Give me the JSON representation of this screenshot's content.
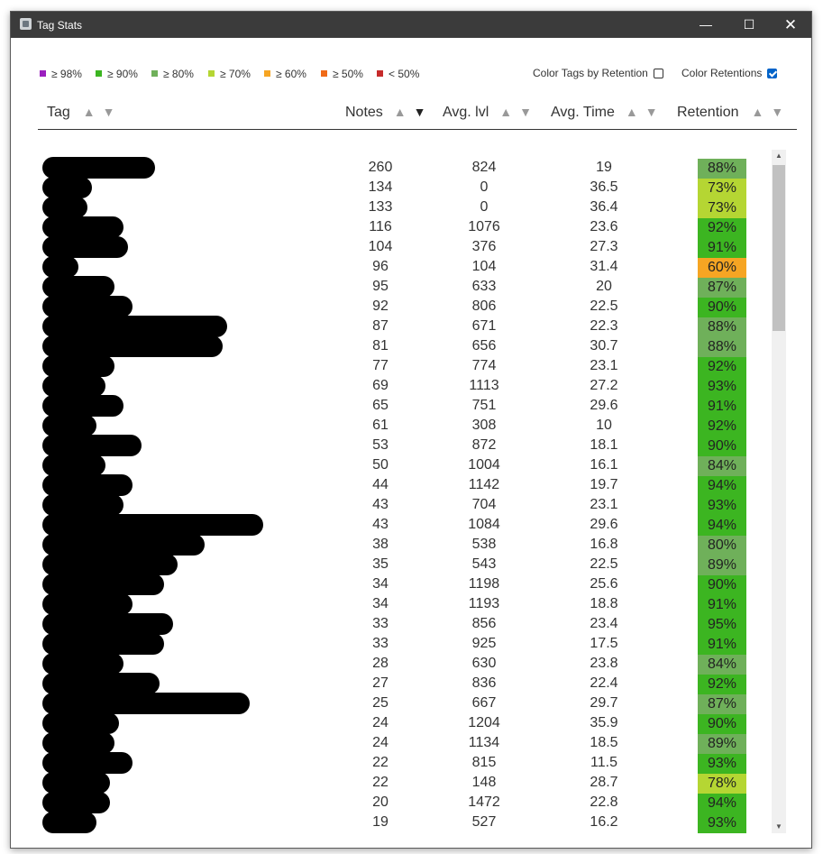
{
  "window": {
    "title": "Tag Stats"
  },
  "legend": [
    {
      "label": "≥ 98%",
      "color": "#9b1fbf"
    },
    {
      "label": "≥ 90%",
      "color": "#3cb521"
    },
    {
      "label": "≥ 80%",
      "color": "#6fb05a"
    },
    {
      "label": "≥ 70%",
      "color": "#b5d633"
    },
    {
      "label": "≥ 60%",
      "color": "#f6a523"
    },
    {
      "label": "≥ 50%",
      "color": "#f06a17"
    },
    {
      "label": "< 50%",
      "color": "#c62b2b"
    }
  ],
  "options": {
    "color_tags_label": "Color Tags by Retention",
    "color_tags_checked": false,
    "color_retentions_label": "Color Retentions",
    "color_retentions_checked": true
  },
  "columns": {
    "tag": "Tag",
    "notes": "Notes",
    "avg_lvl": "Avg. lvl",
    "avg_time": "Avg. Time",
    "retention": "Retention"
  },
  "sort_icons": {
    "up": "▲",
    "down": "▼"
  },
  "rows": [
    {
      "notes": "260",
      "lvl": "824",
      "time": "19",
      "ret": "88%",
      "ret_color": "#6fb05a"
    },
    {
      "notes": "134",
      "lvl": "0",
      "time": "36.5",
      "ret": "73%",
      "ret_color": "#b5d633"
    },
    {
      "notes": "133",
      "lvl": "0",
      "time": "36.4",
      "ret": "73%",
      "ret_color": "#b5d633"
    },
    {
      "notes": "116",
      "lvl": "1076",
      "time": "23.6",
      "ret": "92%",
      "ret_color": "#3cb521"
    },
    {
      "notes": "104",
      "lvl": "376",
      "time": "27.3",
      "ret": "91%",
      "ret_color": "#3cb521"
    },
    {
      "notes": "96",
      "lvl": "104",
      "time": "31.4",
      "ret": "60%",
      "ret_color": "#f6a523"
    },
    {
      "notes": "95",
      "lvl": "633",
      "time": "20",
      "ret": "87%",
      "ret_color": "#6fb05a"
    },
    {
      "notes": "92",
      "lvl": "806",
      "time": "22.5",
      "ret": "90%",
      "ret_color": "#3cb521"
    },
    {
      "notes": "87",
      "lvl": "671",
      "time": "22.3",
      "ret": "88%",
      "ret_color": "#6fb05a"
    },
    {
      "notes": "81",
      "lvl": "656",
      "time": "30.7",
      "ret": "88%",
      "ret_color": "#6fb05a"
    },
    {
      "notes": "77",
      "lvl": "774",
      "time": "23.1",
      "ret": "92%",
      "ret_color": "#3cb521"
    },
    {
      "notes": "69",
      "lvl": "1113",
      "time": "27.2",
      "ret": "93%",
      "ret_color": "#3cb521"
    },
    {
      "notes": "65",
      "lvl": "751",
      "time": "29.6",
      "ret": "91%",
      "ret_color": "#3cb521"
    },
    {
      "notes": "61",
      "lvl": "308",
      "time": "10",
      "ret": "92%",
      "ret_color": "#3cb521"
    },
    {
      "notes": "53",
      "lvl": "872",
      "time": "18.1",
      "ret": "90%",
      "ret_color": "#3cb521"
    },
    {
      "notes": "50",
      "lvl": "1004",
      "time": "16.1",
      "ret": "84%",
      "ret_color": "#6fb05a"
    },
    {
      "notes": "44",
      "lvl": "1142",
      "time": "19.7",
      "ret": "94%",
      "ret_color": "#3cb521"
    },
    {
      "notes": "43",
      "lvl": "704",
      "time": "23.1",
      "ret": "93%",
      "ret_color": "#3cb521"
    },
    {
      "notes": "43",
      "lvl": "1084",
      "time": "29.6",
      "ret": "94%",
      "ret_color": "#3cb521"
    },
    {
      "notes": "38",
      "lvl": "538",
      "time": "16.8",
      "ret": "80%",
      "ret_color": "#6fb05a"
    },
    {
      "notes": "35",
      "lvl": "543",
      "time": "22.5",
      "ret": "89%",
      "ret_color": "#6fb05a"
    },
    {
      "notes": "34",
      "lvl": "1198",
      "time": "25.6",
      "ret": "90%",
      "ret_color": "#3cb521"
    },
    {
      "notes": "34",
      "lvl": "1193",
      "time": "18.8",
      "ret": "91%",
      "ret_color": "#3cb521"
    },
    {
      "notes": "33",
      "lvl": "856",
      "time": "23.4",
      "ret": "95%",
      "ret_color": "#3cb521"
    },
    {
      "notes": "33",
      "lvl": "925",
      "time": "17.5",
      "ret": "91%",
      "ret_color": "#3cb521"
    },
    {
      "notes": "28",
      "lvl": "630",
      "time": "23.8",
      "ret": "84%",
      "ret_color": "#6fb05a"
    },
    {
      "notes": "27",
      "lvl": "836",
      "time": "22.4",
      "ret": "92%",
      "ret_color": "#3cb521"
    },
    {
      "notes": "25",
      "lvl": "667",
      "time": "29.7",
      "ret": "87%",
      "ret_color": "#6fb05a"
    },
    {
      "notes": "24",
      "lvl": "1204",
      "time": "35.9",
      "ret": "90%",
      "ret_color": "#3cb521"
    },
    {
      "notes": "24",
      "lvl": "1134",
      "time": "18.5",
      "ret": "89%",
      "ret_color": "#6fb05a"
    },
    {
      "notes": "22",
      "lvl": "815",
      "time": "11.5",
      "ret": "93%",
      "ret_color": "#3cb521"
    },
    {
      "notes": "22",
      "lvl": "148",
      "time": "28.7",
      "ret": "78%",
      "ret_color": "#b5d633"
    },
    {
      "notes": "20",
      "lvl": "1472",
      "time": "22.8",
      "ret": "94%",
      "ret_color": "#3cb521"
    },
    {
      "notes": "19",
      "lvl": "527",
      "time": "16.2",
      "ret": "93%",
      "ret_color": "#3cb521"
    }
  ]
}
